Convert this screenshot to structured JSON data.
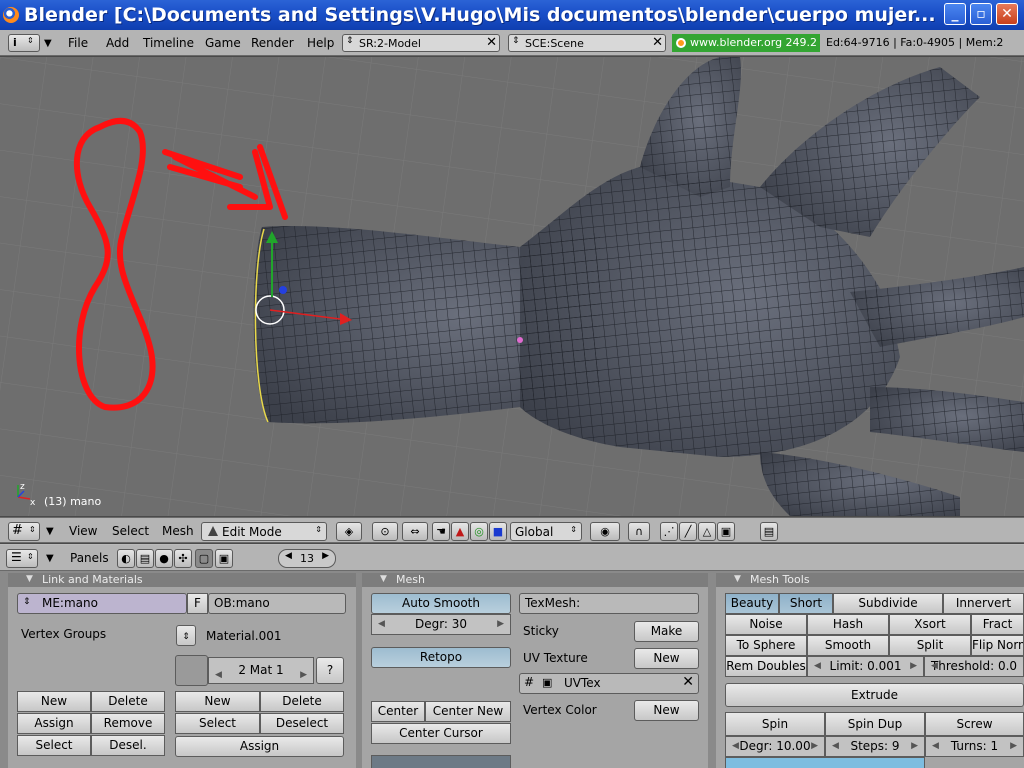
{
  "window": {
    "title": "Blender [C:\\Documents and Settings\\V.Hugo\\Mis documentos\\blender\\cuerpo mujer...",
    "min_label": "_",
    "max_label": "▫",
    "close_label": "✕"
  },
  "info_header": {
    "menus": [
      "File",
      "Add",
      "Timeline",
      "Game",
      "Render",
      "Help"
    ],
    "screen_browse": "SR:2-Model",
    "scene_browse": "SCE:Scene",
    "url": "www.blender.org 249.2",
    "stats": "Ed:64-9716 | Fa:0-4905 | Mem:2"
  },
  "viewport": {
    "object_label": "(13) mano",
    "axis_z": "z",
    "axis_x": "x"
  },
  "view3d_header": {
    "menus": [
      "View",
      "Select",
      "Mesh"
    ],
    "mode": "Edit Mode",
    "orientation": "Global"
  },
  "buttons_header": {
    "panels_label": "Panels",
    "frame": "13"
  },
  "link_materials": {
    "title": "Link and Materials",
    "mesh_name": "ME:mano",
    "f_label": "F",
    "object_name": "OB:mano",
    "vertex_groups_label": "Vertex Groups",
    "material_name": "Material.001",
    "mat_index": "2 Mat 1",
    "question": "?",
    "vg_buttons": {
      "new": "New",
      "delete": "Delete",
      "assign": "Assign",
      "remove": "Remove",
      "select": "Select",
      "deselect": "Desel."
    },
    "mat_buttons": {
      "new": "New",
      "delete": "Delete",
      "select": "Select",
      "deselect": "Deselect",
      "assign": "Assign"
    }
  },
  "mesh": {
    "title": "Mesh",
    "auto_smooth": "Auto Smooth",
    "degr": "Degr: 30",
    "retopo": "Retopo",
    "center": "Center",
    "center_new": "Center New",
    "center_cursor": "Center Cursor",
    "texmesh": "TexMesh:",
    "sticky": "Sticky",
    "make": "Make",
    "uv_texture": "UV Texture",
    "uv_new": "New",
    "uvtex": "UVTex",
    "vertex_color": "Vertex Color",
    "vc_new": "New"
  },
  "mesh_tools": {
    "title": "Mesh Tools",
    "beauty": "Beauty",
    "short": "Short",
    "subdivide": "Subdivide",
    "innervert": "Innervert",
    "noise": "Noise",
    "hash": "Hash",
    "xsort": "Xsort",
    "fractal": "Fract",
    "to_sphere": "To Sphere",
    "smooth": "Smooth",
    "split": "Split",
    "flip_normals": "Flip Norm",
    "rem_doubles": "Rem Doubles",
    "limit": "Limit: 0.001",
    "threshold": "Threshold: 0.0",
    "extrude": "Extrude",
    "spin": "Spin",
    "spin_dup": "Spin Dup",
    "screw": "Screw",
    "degr": "Degr: 10.00",
    "steps": "Steps: 9",
    "turns": "Turns: 1"
  },
  "colors": {
    "background": "#6e6e6e",
    "mesh": "#4b4f5a",
    "annotation": "#ff1010",
    "header": "#b4b4b4",
    "panel": "#a5a5a5"
  }
}
